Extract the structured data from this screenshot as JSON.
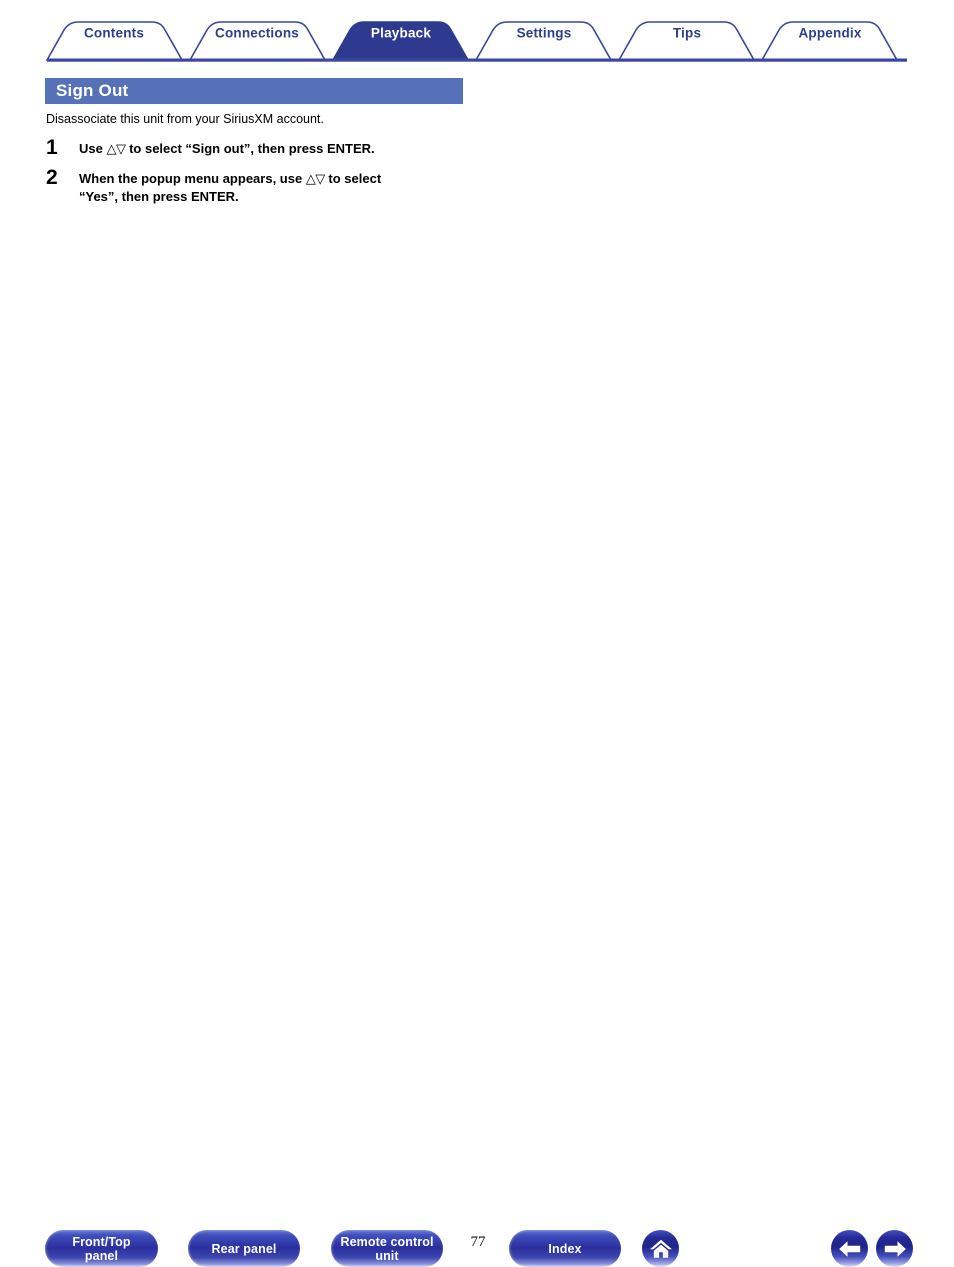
{
  "tabs": [
    {
      "label": "Contents",
      "active": false,
      "center": 114
    },
    {
      "label": "Connections",
      "active": false,
      "center": 257
    },
    {
      "label": "Playback",
      "active": true,
      "center": 401
    },
    {
      "label": "Settings",
      "active": false,
      "center": 544
    },
    {
      "label": "Tips",
      "active": false,
      "center": 687
    },
    {
      "label": "Appendix",
      "active": false,
      "center": 830
    }
  ],
  "section": {
    "title": "Sign Out",
    "intro": "Disassociate this unit from your SiriusXM account."
  },
  "steps": [
    {
      "number": "1",
      "line1_pre": "Use ",
      "arrows": "△▽",
      "line1_post": " to select “Sign out”, then press ENTER.",
      "line2": ""
    },
    {
      "number": "2",
      "line1_pre": "When the popup menu appears, use ",
      "arrows": "△▽",
      "line1_post": " to select",
      "line2": "“Yes”, then press ENTER."
    }
  ],
  "footer": {
    "front_top_panel": "Front/Top\npanel",
    "front_top_panel_line1": "Front/Top",
    "front_top_panel_line2": "panel",
    "rear_panel": "Rear panel",
    "remote_control_line1": "Remote control",
    "remote_control_line2": "unit",
    "index": "Index",
    "page_number": "77",
    "home_icon": "home-icon",
    "prev_icon": "arrow-left-icon",
    "next_icon": "arrow-right-icon"
  },
  "colors": {
    "tab_border": "#3a46a0",
    "tab_text": "#2d3f8f",
    "tab_active_bg": "#2d3a8f",
    "title_bar_bg": "#5571b8",
    "button_blue": "#2a2f9e"
  }
}
